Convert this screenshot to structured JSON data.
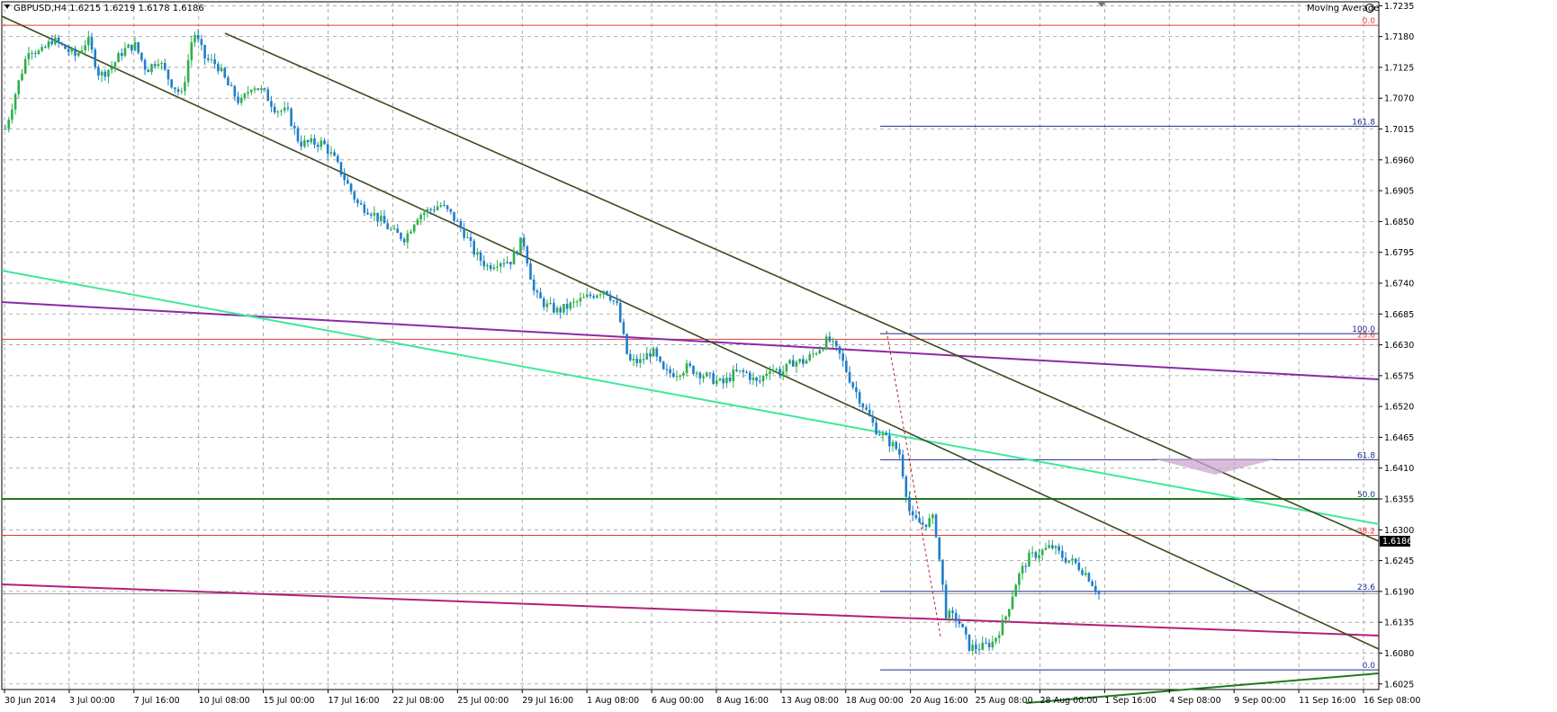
{
  "header": {
    "symbol_line": "GBPUSD,H4  1.6215 1.6219 1.6178 1.6186",
    "indicator": "Moving Average"
  },
  "current_price_label": "1.6186",
  "colors": {
    "bull": "#2db04a",
    "bear": "#1e7ec8",
    "grid": "#9a9a9a",
    "channel": "#3d4a1f",
    "red_level": "#e03c3c",
    "fibo_blue": "#1c2a8c",
    "ma_purple": "#8a2aa8",
    "ma_green": "#3fe89a",
    "ma_magenta": "#b0207a",
    "support_green": "#1f7a1f"
  },
  "chart_data": {
    "type": "candlestick",
    "title": "",
    "symbol": "GBPUSD",
    "timeframe": "H4",
    "ohlc_last": {
      "open": 1.6215,
      "high": 1.6219,
      "low": 1.6178,
      "close": 1.6186
    },
    "y_ticks": [
      "1.7235",
      "1.7180",
      "1.7125",
      "1.7070",
      "1.7015",
      "1.6960",
      "1.6905",
      "1.6850",
      "1.6795",
      "1.6740",
      "1.6685",
      "1.6630",
      "1.6575",
      "1.6520",
      "1.6465",
      "1.6410",
      "1.6355",
      "1.6300",
      "1.6245",
      "1.6190",
      "1.6135",
      "1.6080",
      "1.6025"
    ],
    "x_ticks": [
      "30 Jun 2014",
      "3 Jul 00:00",
      "7 Jul 16:00",
      "10 Jul 08:00",
      "15 Jul 00:00",
      "17 Jul 16:00",
      "22 Jul 08:00",
      "25 Jul 00:00",
      "29 Jul 16:00",
      "1 Aug 08:00",
      "6 Aug 00:00",
      "8 Aug 16:00",
      "13 Aug 08:00",
      "18 Aug 00:00",
      "20 Aug 16:00",
      "25 Aug 08:00",
      "28 Aug 00:00",
      "1 Sep 16:00",
      "4 Sep 08:00",
      "9 Sep 00:00",
      "11 Sep 16:00",
      "16 Sep 08:00"
    ],
    "ylim": [
      1.6015,
      1.7242
    ],
    "grid": true,
    "price_path": [
      1.7015,
      1.709,
      1.716,
      1.715,
      1.7175,
      1.716,
      1.7145,
      1.7175,
      1.711,
      1.7125,
      1.7155,
      1.7165,
      1.712,
      1.714,
      1.71,
      1.7075,
      1.719,
      1.714,
      1.713,
      1.709,
      1.706,
      1.7095,
      1.708,
      1.705,
      1.7045,
      1.699,
      1.699,
      1.699,
      1.696,
      1.692,
      1.688,
      1.687,
      1.685,
      1.683,
      1.682,
      1.686,
      1.687,
      1.688,
      1.686,
      1.683,
      1.679,
      1.677,
      1.678,
      1.678,
      1.682,
      1.672,
      1.67,
      1.669,
      1.67,
      1.671,
      1.672,
      1.673,
      1.67,
      1.66,
      1.66,
      1.662,
      1.658,
      1.658,
      1.659,
      1.658,
      1.657,
      1.656,
      1.658,
      1.658,
      1.656,
      1.659,
      1.658,
      1.66,
      1.66,
      1.662,
      1.664,
      1.661,
      1.656,
      1.652,
      1.648,
      1.646,
      1.644,
      1.632,
      1.631,
      1.632,
      1.615,
      1.614,
      1.609,
      1.609,
      1.61,
      1.614,
      1.621,
      1.625,
      1.626,
      1.627,
      1.625,
      1.624,
      1.622,
      1.6186
    ],
    "horizontal_levels": [
      {
        "label": "0.0",
        "price": 1.72,
        "color": "#e03c3c"
      },
      {
        "label": "23.6",
        "price": 1.664,
        "color": "#e03c3c"
      },
      {
        "label": "38.2",
        "price": 1.629,
        "color": "#e03c3c"
      },
      {
        "label": "161.8",
        "price": 1.702,
        "color": "#1c2a8c"
      },
      {
        "label": "100.0",
        "price": 1.665,
        "color": "#1c2a8c"
      },
      {
        "label": "61.8",
        "price": 1.6425,
        "color": "#1c2a8c"
      },
      {
        "label": "50.0",
        "price": 1.6355,
        "color": "#1c2a8c"
      },
      {
        "label": "23.6",
        "price": 1.619,
        "color": "#1c2a8c"
      },
      {
        "label": "0.0",
        "price": 1.605,
        "color": "#1c2a8c"
      }
    ]
  }
}
